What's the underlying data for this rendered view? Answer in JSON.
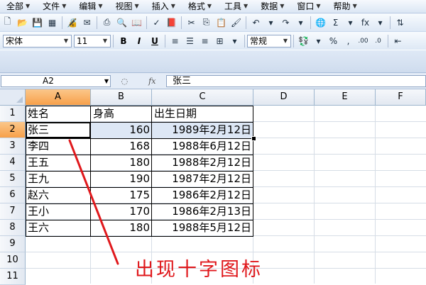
{
  "menus": [
    {
      "label": "全部"
    },
    {
      "label": "文件"
    },
    {
      "label": "编辑"
    },
    {
      "label": "视图"
    },
    {
      "label": "插入"
    },
    {
      "label": "格式"
    },
    {
      "label": "工具"
    },
    {
      "label": "数据"
    },
    {
      "label": "窗口"
    },
    {
      "label": "帮助"
    }
  ],
  "toolbar": {
    "font_name": "宋体",
    "font_size": "11",
    "bold_label": "B",
    "italic_label": "I",
    "underline_label": "U",
    "number_format": "常规",
    "sum_label": "Σ",
    "fx_label": "fx"
  },
  "formula_bar": {
    "name_box": "A2",
    "fx_label": "fx",
    "value": "张三"
  },
  "columns": [
    "A",
    "B",
    "C",
    "D",
    "E",
    "F"
  ],
  "rows": [
    "1",
    "2",
    "3",
    "4",
    "5",
    "6",
    "7",
    "8",
    "9",
    "10",
    "11"
  ],
  "table": {
    "headers": [
      "姓名",
      "身高",
      "出生日期"
    ],
    "rows": [
      [
        "张三",
        "160",
        "1989年2月12日"
      ],
      [
        "李四",
        "168",
        "1988年6月12日"
      ],
      [
        "王五",
        "180",
        "1988年2月12日"
      ],
      [
        "王九",
        "190",
        "1987年2月12日"
      ],
      [
        "赵六",
        "175",
        "1986年2月12日"
      ],
      [
        "王小",
        "170",
        "1986年2月13日"
      ],
      [
        "王六",
        "180",
        "1988年5月12日"
      ]
    ]
  },
  "annotation": {
    "text": "出现十字图标",
    "color": "#e0181c"
  }
}
